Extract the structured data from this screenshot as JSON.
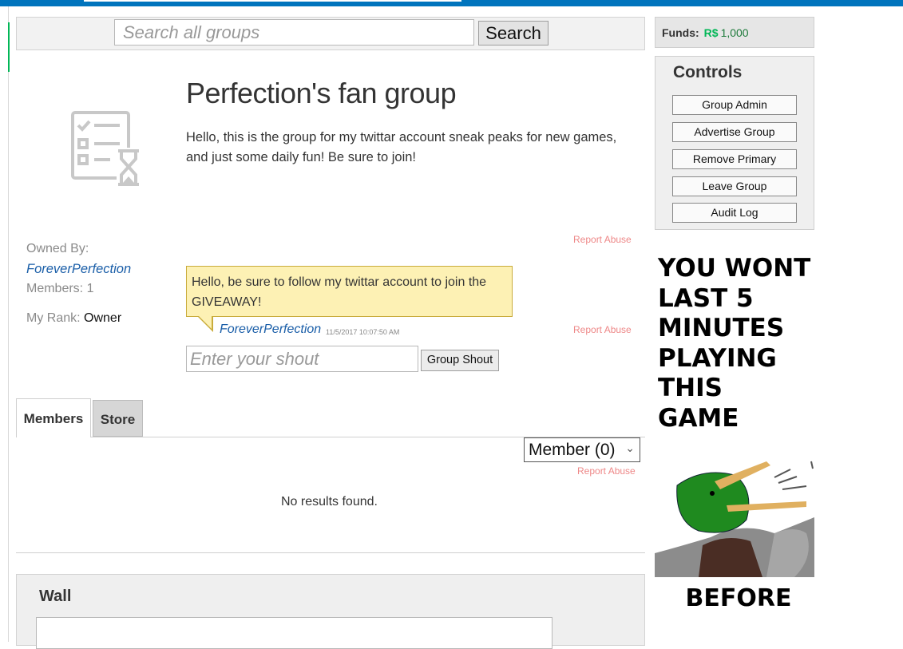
{
  "search": {
    "placeholder": "Search all groups",
    "button_label": "Search"
  },
  "group": {
    "title": "Perfection's fan group",
    "description": "Hello, this is the group for my twittar account sneak peaks for new games, and just some daily fun! Be sure to join!",
    "report_abuse": "Report Abuse",
    "owned_by_label": "Owned By:",
    "owner_name": "ForeverPerfection",
    "members_label": "Members: 1",
    "my_rank_label": "My Rank:",
    "my_rank_value": "Owner"
  },
  "shout": {
    "message": "Hello, be sure to follow my twittar account to join the GIVEAWAY!",
    "author": "ForeverPerfection",
    "timestamp": "11/5/2017 10:07:50 AM",
    "report_abuse": "Report Abuse",
    "input_placeholder": "Enter your shout",
    "button_label": "Group Shout"
  },
  "tabs": [
    {
      "label": "Members",
      "active": true
    },
    {
      "label": "Store",
      "active": false
    }
  ],
  "members_panel": {
    "rank_select_value": "Member (0)",
    "report_abuse": "Report Abuse",
    "empty_text": "No results found."
  },
  "wall": {
    "title": "Wall"
  },
  "sidebar": {
    "funds_label": "Funds:",
    "funds_currency": "R$",
    "funds_amount": "1,000",
    "controls_title": "Controls",
    "controls": [
      "Group Admin",
      "Advertise Group",
      "Remove Primary",
      "Leave Group",
      "Audit Log"
    ]
  },
  "ad": {
    "lines": [
      "YOU WONT",
      "LAST 5",
      "MINUTES",
      "PLAYING",
      "THIS",
      "GAME"
    ],
    "caption": "BEFORE"
  },
  "colors": {
    "topbar": "#0074bd",
    "link": "#1a5ea8",
    "report": "#ee8888",
    "shout_bg": "#fdf1b4",
    "robux": "#02b757"
  }
}
